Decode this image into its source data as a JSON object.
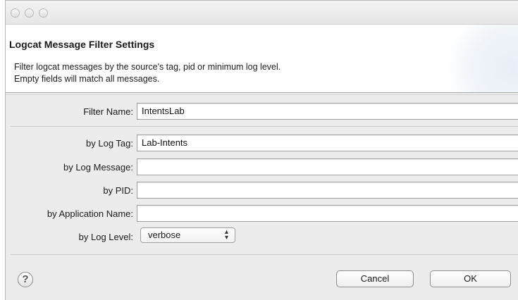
{
  "dialog": {
    "title": "Logcat Message Filter Settings",
    "description_line1": "Filter logcat messages by the source's tag, pid or minimum log level.",
    "description_line2": "Empty fields will match all messages."
  },
  "form": {
    "filter_name_label": "Filter Name:",
    "filter_name_value": "IntentsLab",
    "log_tag_label": "by Log Tag:",
    "log_tag_value": "Lab-Intents",
    "log_message_label": "by Log Message:",
    "log_message_value": "",
    "pid_label": "by PID:",
    "pid_value": "",
    "app_name_label": "by Application Name:",
    "app_name_value": "",
    "log_level_label": "by Log Level:",
    "log_level_value": "verbose"
  },
  "buttons": {
    "help": "?",
    "cancel": "Cancel",
    "ok": "OK"
  },
  "icons": {
    "close": "close-icon",
    "minimize": "minimize-icon",
    "zoom": "zoom-icon",
    "select_arrows": "up-down-arrows-icon"
  }
}
